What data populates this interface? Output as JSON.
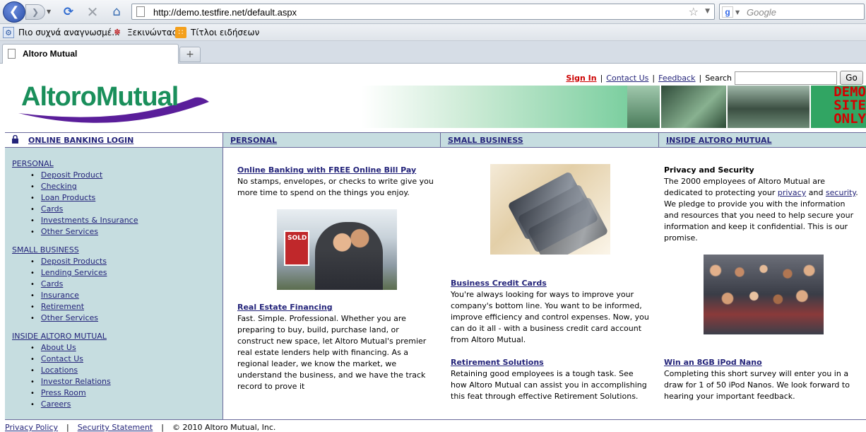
{
  "browser": {
    "url": "http://demo.testfire.net/default.aspx",
    "search_placeholder": "Google",
    "bookmarks": [
      "Πιο συχνά αναγνωσμέ...",
      "Ξεκινώντας",
      "Τίτλοι ειδήσεων"
    ],
    "tab_title": "Altoro Mutual"
  },
  "header": {
    "logo_text": "AltoroMutual",
    "sign_in": "Sign In",
    "contact_us": "Contact Us",
    "feedback": "Feedback",
    "search_label": "Search",
    "go_label": "Go",
    "separator": "|",
    "demo_lines": [
      "DEMO",
      "SITE",
      "ONLY"
    ]
  },
  "menu": {
    "login": "ONLINE BANKING LOGIN",
    "personal": "PERSONAL",
    "small_business": "SMALL BUSINESS",
    "inside": "INSIDE ALTORO MUTUAL"
  },
  "sidebar": {
    "personal_title": "PERSONAL",
    "personal_items": [
      "Deposit Product",
      "Checking",
      "Loan Products",
      "Cards",
      "Investments & Insurance",
      "Other Services"
    ],
    "business_title": "SMALL BUSINESS",
    "business_items": [
      "Deposit Products",
      "Lending Services",
      "Cards",
      "Insurance",
      "Retirement",
      "Other Services"
    ],
    "inside_title": "INSIDE ALTORO MUTUAL",
    "inside_items": [
      "About Us",
      "Contact Us",
      "Locations",
      "Investor Relations",
      "Press Room",
      "Careers"
    ]
  },
  "content": {
    "online_banking_title": "Online Banking with FREE Online Bill Pay",
    "online_banking_text": "No stamps, envelopes, or checks to write give you more time to spend on the things you enjoy.",
    "sold_sign": "SOLD",
    "real_estate_title": "Real Estate Financing",
    "real_estate_text": "Fast. Simple. Professional. Whether you are preparing to buy, build, purchase land, or construct new space, let Altoro Mutual's premier real estate lenders help with financing. As a regional leader, we know the market, we understand the business, and we have the track record to prove it",
    "credit_cards_title": "Business Credit Cards",
    "credit_cards_text": "You're always looking for ways to improve your company's bottom line. You want to be informed, improve efficiency and control expenses. Now, you can do it all - with a business credit card account from Altoro Mutual.",
    "retirement_title": "Retirement Solutions",
    "retirement_text": "Retaining good employees is a tough task. See how Altoro Mutual can assist you in accomplishing this feat through effective Retirement Solutions.",
    "privacy_title": "Privacy and Security",
    "privacy_text_1": "The 2000 employees of Altoro Mutual are dedicated to protecting your",
    "privacy_link": "privacy",
    "privacy_and": "and",
    "security_link": "security",
    "privacy_text_2": ". We pledge to provide you with the information and resources that you need to help secure your information and keep it confidential. This is our promise.",
    "ipod_title": "Win an 8GB iPod Nano",
    "ipod_text": "Completing this short survey will enter you in a draw for 1 of 50 iPod Nanos. We look forward to hearing your important feedback."
  },
  "footer": {
    "privacy_policy": "Privacy Policy",
    "security_statement": "Security Statement",
    "copyright": "© 2010 Altoro Mutual, Inc.",
    "separator": "|"
  }
}
